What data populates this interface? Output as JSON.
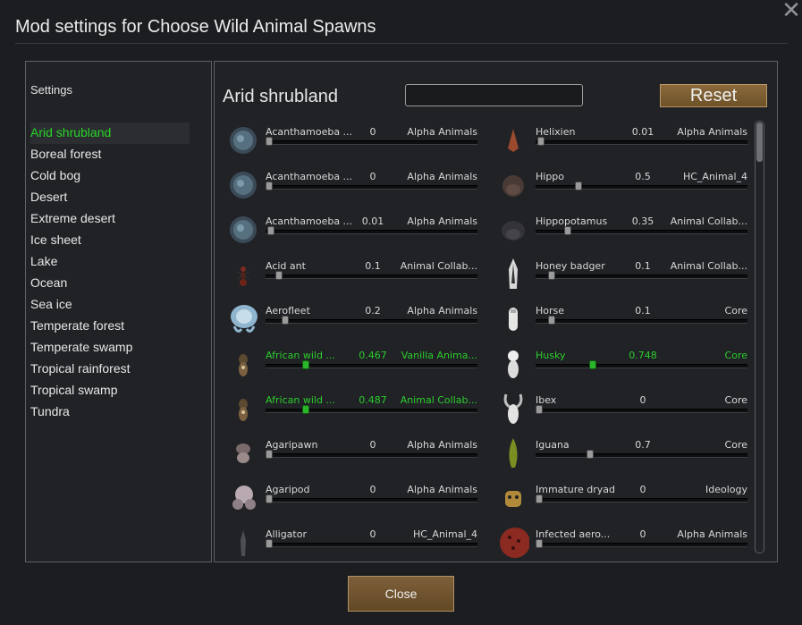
{
  "window": {
    "title": "Mod settings for Choose Wild Animal Spawns",
    "close_glyph": "✕"
  },
  "sidebar": {
    "label": "Settings",
    "selected_color": "#27d627",
    "items": [
      {
        "label": "Arid shrubland",
        "selected": true
      },
      {
        "label": "Boreal forest"
      },
      {
        "label": "Cold bog"
      },
      {
        "label": "Desert"
      },
      {
        "label": "Extreme desert"
      },
      {
        "label": "Ice sheet"
      },
      {
        "label": "Lake"
      },
      {
        "label": "Ocean"
      },
      {
        "label": "Sea ice"
      },
      {
        "label": "Temperate forest"
      },
      {
        "label": "Temperate swamp"
      },
      {
        "label": "Tropical rainforest"
      },
      {
        "label": "Tropical swamp"
      },
      {
        "label": "Tundra"
      }
    ]
  },
  "main": {
    "biome_title": "Arid shrubland",
    "search": {
      "value": "",
      "placeholder": ""
    },
    "reset_label": "Reset",
    "left_column": [
      {
        "name": "Acanthamoeba ...",
        "value": "0",
        "source": "Alpha Animals",
        "slider": 0.0,
        "on": false,
        "icon": "amoeba-icon"
      },
      {
        "name": "Acanthamoeba ...",
        "value": "0",
        "source": "Alpha Animals",
        "slider": 0.0,
        "on": false,
        "icon": "amoeba-icon"
      },
      {
        "name": "Acanthamoeba ...",
        "value": "0.01",
        "source": "Alpha Animals",
        "slider": 0.01,
        "on": false,
        "icon": "amoeba-icon"
      },
      {
        "name": "Acid ant",
        "value": "0.1",
        "source": "Animal Collab...",
        "slider": 0.05,
        "on": false,
        "icon": "ant-icon"
      },
      {
        "name": "Aerofleet",
        "value": "0.2",
        "source": "Alpha Animals",
        "slider": 0.08,
        "on": false,
        "icon": "aerofleet-icon"
      },
      {
        "name": "African wild ...",
        "value": "0.467",
        "source": "Vanilla Anima...",
        "slider": 0.18,
        "on": true,
        "icon": "wild-dog-icon"
      },
      {
        "name": "African wild ...",
        "value": "0.487",
        "source": "Animal Collab...",
        "slider": 0.18,
        "on": true,
        "icon": "wild-dog-icon"
      },
      {
        "name": "Agaripawn",
        "value": "0",
        "source": "Alpha Animals",
        "slider": 0.0,
        "on": false,
        "icon": "agaripawn-icon"
      },
      {
        "name": "Agaripod",
        "value": "0",
        "source": "Alpha Animals",
        "slider": 0.0,
        "on": false,
        "icon": "agaripod-icon"
      },
      {
        "name": "Alligator",
        "value": "0",
        "source": "HC_Animal_4",
        "slider": 0.0,
        "on": false,
        "icon": "alligator-icon"
      }
    ],
    "right_column": [
      {
        "name": "Helixien",
        "value": "0.01",
        "source": "Alpha Animals",
        "slider": 0.01,
        "on": false,
        "icon": "helixien-icon"
      },
      {
        "name": "Hippo",
        "value": "0.5",
        "source": "HC_Animal_4",
        "slider": 0.19,
        "on": false,
        "icon": "hippo-icon"
      },
      {
        "name": "Hippopotamus",
        "value": "0.35",
        "source": "Animal Collab...",
        "slider": 0.14,
        "on": false,
        "icon": "hippopotamus-icon"
      },
      {
        "name": "Honey badger",
        "value": "0.1",
        "source": "Animal Collab...",
        "slider": 0.06,
        "on": false,
        "icon": "honey-badger-icon"
      },
      {
        "name": "Horse",
        "value": "0.1",
        "source": "Core",
        "slider": 0.06,
        "on": false,
        "icon": "horse-icon"
      },
      {
        "name": "Husky",
        "value": "0.748",
        "source": "Core",
        "slider": 0.26,
        "on": true,
        "icon": "husky-icon"
      },
      {
        "name": "Ibex",
        "value": "0",
        "source": "Core",
        "slider": 0.0,
        "on": false,
        "icon": "ibex-icon"
      },
      {
        "name": "Iguana",
        "value": "0.7",
        "source": "Core",
        "slider": 0.25,
        "on": false,
        "icon": "iguana-icon"
      },
      {
        "name": "Immature dryad",
        "value": "0",
        "source": "Ideology",
        "slider": 0.0,
        "on": false,
        "icon": "dryad-icon"
      },
      {
        "name": "Infected aero...",
        "value": "0",
        "source": "Alpha Animals",
        "slider": 0.0,
        "on": false,
        "icon": "infected-aerofleet-icon"
      }
    ]
  },
  "footer": {
    "close_label": "Close"
  },
  "colors": {
    "enabled_text": "#2ccd2c",
    "button_brown": "#7d603a",
    "panel_bg": "#202226"
  }
}
